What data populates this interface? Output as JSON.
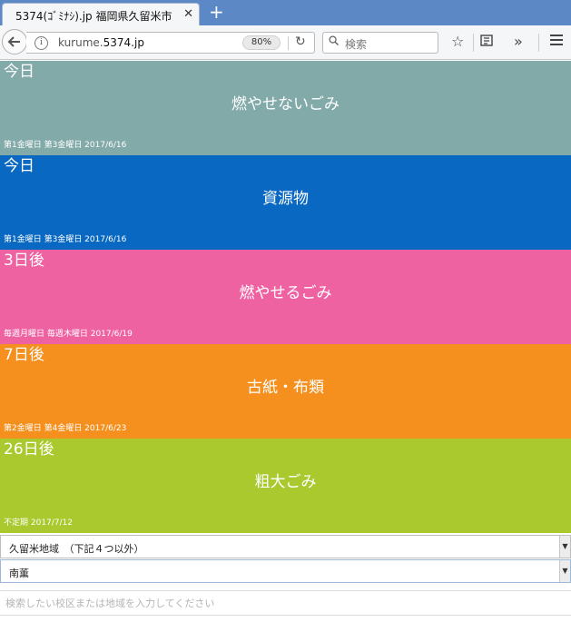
{
  "browser": {
    "tab_title": "5374(ｺﾞﾐﾅｼ).jp 福岡県久留米市",
    "tab_close": "✕",
    "new_tab": "+",
    "url_prefix": "kurume.",
    "url_host": "5374.jp",
    "zoom": "80%",
    "search_placeholder": "検索",
    "overflow": "»"
  },
  "schedule": [
    {
      "days": "今日",
      "name": "燃やせないごみ",
      "next": "第1金曜日 第3金曜日 2017/6/16",
      "color": "#82aaa9"
    },
    {
      "days": "今日",
      "name": "資源物",
      "next": "第1金曜日 第3金曜日 2017/6/16",
      "color": "#0868c2"
    },
    {
      "days": "3日後",
      "name": "燃やせるごみ",
      "next": "毎週月曜日 毎週木曜日 2017/6/19",
      "color": "#ef62a2"
    },
    {
      "days": "7日後",
      "name": "古紙・布類",
      "next": "第2金曜日 第4金曜日 2017/6/23",
      "color": "#f5901e"
    },
    {
      "days": "26日後",
      "name": "粗大ごみ",
      "next": "不定期 2017/7/12",
      "color": "#a9c92e"
    }
  ],
  "area_select": {
    "value": "久留米地域　（下記４つ以外）"
  },
  "district_select": {
    "value": "南薫"
  },
  "search": {
    "placeholder": "検索したい校区または地域を入力してください"
  }
}
